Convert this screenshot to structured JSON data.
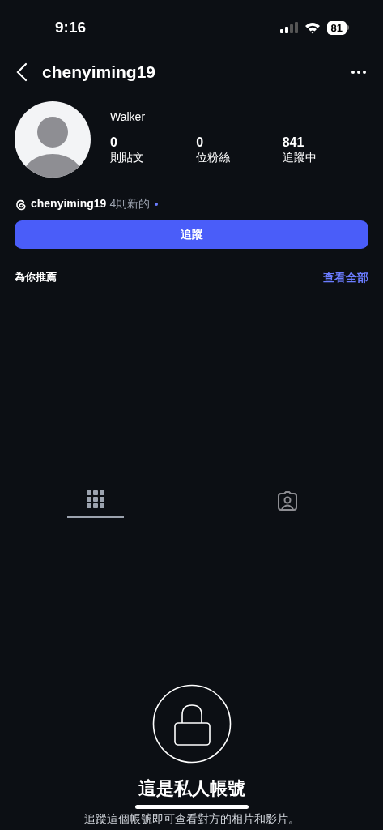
{
  "status_bar": {
    "time": "9:16",
    "battery": "81"
  },
  "header": {
    "username": "chenyiming19"
  },
  "profile": {
    "name": "Walker",
    "stats": [
      {
        "value": "0",
        "label": "則貼文"
      },
      {
        "value": "0",
        "label": "位粉絲"
      },
      {
        "value": "841",
        "label": "追蹤中"
      }
    ],
    "threads": {
      "username": "chenyiming19",
      "new_count": "4則新的"
    },
    "follow_button": "追蹤"
  },
  "suggestions": {
    "title": "為你推薦",
    "see_all": "查看全部"
  },
  "tabs": [
    {
      "kind": "grid",
      "selected": true
    },
    {
      "kind": "tagged",
      "selected": false
    }
  ],
  "private_notice": {
    "title": "這是私人帳號",
    "message": "追蹤這個帳號即可查看對方的相片和影片。"
  }
}
